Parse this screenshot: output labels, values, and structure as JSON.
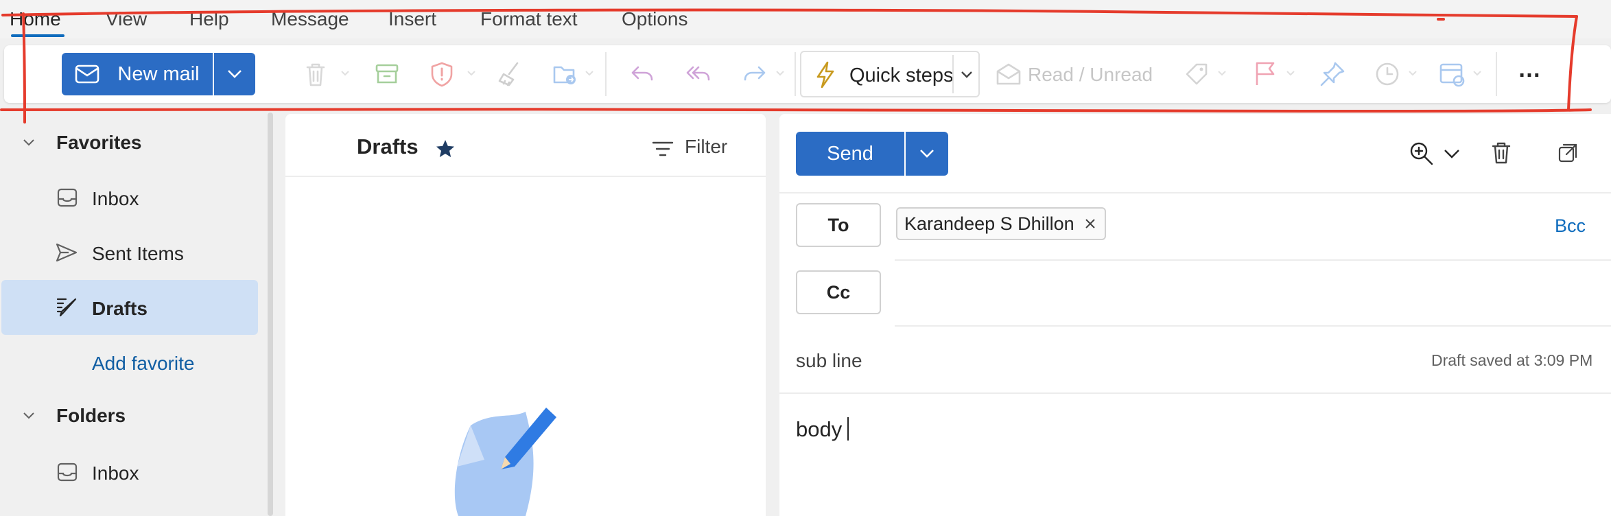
{
  "tabs": [
    {
      "label": "Home"
    },
    {
      "label": "View"
    },
    {
      "label": "Help"
    },
    {
      "label": "Message"
    },
    {
      "label": "Insert"
    },
    {
      "label": "Format text"
    },
    {
      "label": "Options"
    }
  ],
  "ribbon": {
    "new_mail_label": "New mail",
    "quick_steps_label": "Quick steps",
    "read_unread_label": "Read / Unread",
    "more_label": "…",
    "icons": [
      "menu-icon",
      "mail-icon",
      "delete-icon",
      "archive-icon",
      "report-icon",
      "sweep-icon",
      "move-icon",
      "reply-icon",
      "reply-all-icon",
      "forward-icon",
      "lightning-icon",
      "envelope-open-icon",
      "tag-icon",
      "flag-icon",
      "pin-icon",
      "clock-icon",
      "rules-icon",
      "more-icon"
    ]
  },
  "nav": {
    "favorites_label": "Favorites",
    "favorites": [
      {
        "label": "Inbox",
        "icon": "inbox-icon"
      },
      {
        "label": "Sent Items",
        "icon": "send-icon"
      },
      {
        "label": "Drafts",
        "icon": "drafts-icon",
        "selected": true
      }
    ],
    "add_favorite_label": "Add favorite",
    "folders_label": "Folders",
    "folders": [
      {
        "label": "Inbox",
        "icon": "inbox-icon"
      }
    ]
  },
  "list": {
    "title": "Drafts",
    "filter_label": "Filter"
  },
  "compose": {
    "send_label": "Send",
    "to_label": "To",
    "cc_label": "Cc",
    "bcc_label": "Bcc",
    "recipient": "Karandeep S Dhillon",
    "subject": "sub line",
    "draft_status": "Draft saved at 3:09 PM",
    "body": "body"
  },
  "colors": {
    "accent": "#2b6cc4",
    "selected_nav": "#cfe0f5",
    "link": "#0f6cbd",
    "annotation": "#e53b2c"
  }
}
